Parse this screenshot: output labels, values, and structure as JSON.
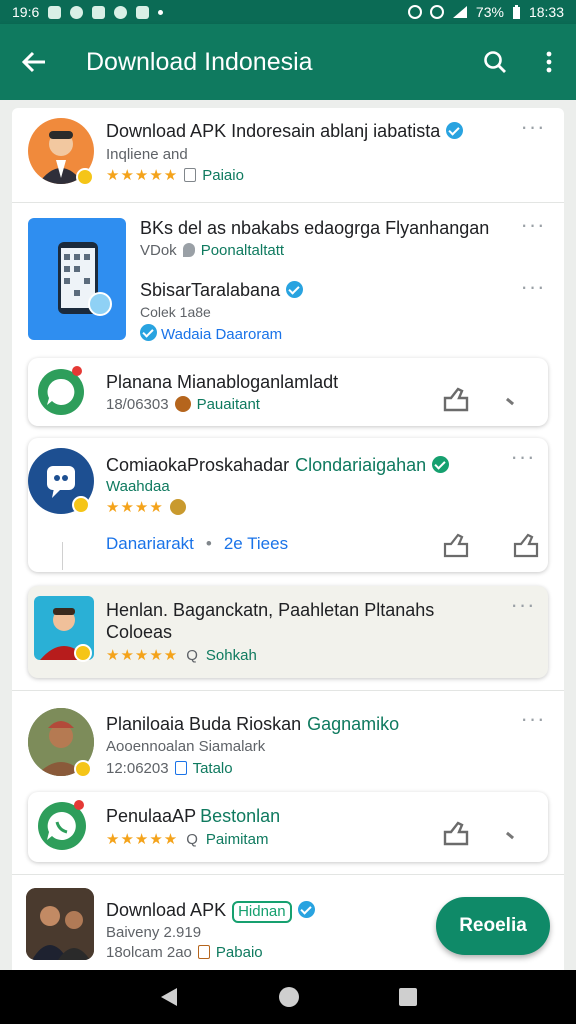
{
  "status_bar": {
    "time_left": "19:6",
    "battery": "73%",
    "time_right": "18:33"
  },
  "app_bar": {
    "title": "Download Indonesia"
  },
  "items": [
    {
      "title": "Download APK Indoresain ablanj iabatista",
      "subtitle": "Inqliene and",
      "meta": "Paiaio"
    },
    {
      "title": "BKs del as nbakabs edaogrga Flyanhangan",
      "subtitle": "VDok",
      "subtitle2": "Poonaltaltatt",
      "title2": "SbisarTaralabana",
      "subtitle3": "Colek 1a8e",
      "meta": "Wadaia Daaroram"
    },
    {
      "title": "Planana Mianabloganlamladt",
      "subtitle": "18/06303",
      "meta": "Pauaitant"
    },
    {
      "title": "ComiaokaProskahadar",
      "title_suffix": "Clondariaigahan",
      "subtitle": "Waahdaa",
      "action_left": "Danariarakt",
      "action_right": "2e Tiees"
    },
    {
      "title": "Henlan. Baganckatn, Paahletan Pltanahs",
      "title_line2": "Coloeas",
      "meta": "Sohkah"
    },
    {
      "title": "Planiloaia Buda Rioskan",
      "title_suffix": "Gagnamiko",
      "subtitle": "Aooennoalan Siamalark",
      "date": "12:06203",
      "meta": "Tatalo"
    },
    {
      "title": "PenulaaAP",
      "title_suffix": "Bestonlan",
      "meta": "Paimitam"
    },
    {
      "title": "Download APK",
      "tag": "Hidnan",
      "subtitle": "Baiveny 2.919",
      "date": "18olcam 2ao",
      "meta": "Pabaio"
    }
  ],
  "fab": {
    "label": "Reoelia"
  },
  "colors": {
    "primary": "#0f7a5f",
    "status_bar": "#0b6b55",
    "star": "#f4a31b",
    "verified": "#16a06f"
  }
}
